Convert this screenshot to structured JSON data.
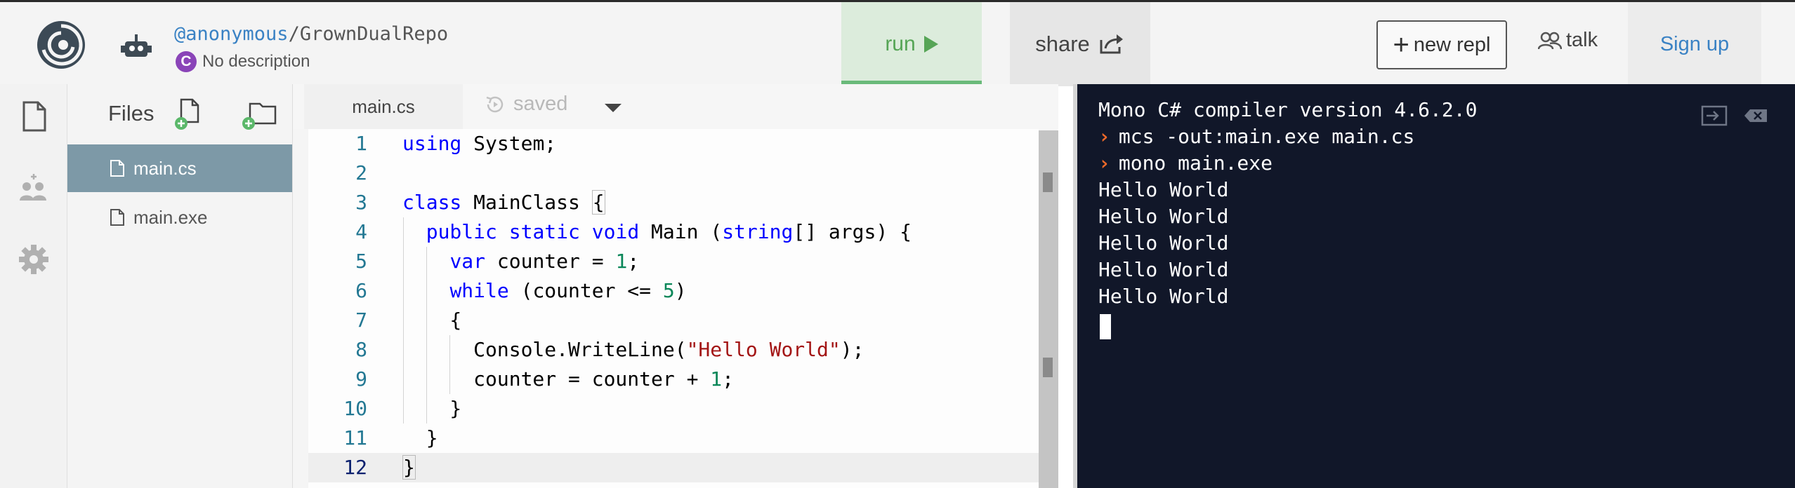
{
  "header": {
    "repo_owner": "@anonymous",
    "repo_separator": "/",
    "repo_name": "GrownDualRepo",
    "description": "No description",
    "language_badge": "C",
    "run_label": "run",
    "share_label": "share",
    "new_repl_label": "new repl",
    "talk_label": "talk",
    "signup_label": "Sign up"
  },
  "rail": {
    "icons": [
      "files-icon",
      "invite-users-icon",
      "settings-gear-icon"
    ]
  },
  "files": {
    "title": "Files",
    "items": [
      {
        "name": "main.cs",
        "active": true
      },
      {
        "name": "main.exe",
        "active": false
      }
    ]
  },
  "editor": {
    "tab_label": "main.cs",
    "status": "saved",
    "current_line": 12,
    "line_numbers": [
      "1",
      "2",
      "3",
      "4",
      "5",
      "6",
      "7",
      "8",
      "9",
      "10",
      "11",
      "12"
    ]
  },
  "console": {
    "lines": [
      "Mono C# compiler version 4.6.2.0",
      "mcs -out:main.exe main.cs",
      "mono main.exe",
      "Hello World",
      "Hello World",
      "Hello World",
      "Hello World",
      "Hello World"
    ],
    "prompt_lines": [
      1,
      2
    ]
  },
  "colors": {
    "accent_link": "#3a82c4",
    "run_green": "#56a556",
    "console_bg": "#111729",
    "file_selected": "#7d99a7",
    "prompt_orange": "#f06a2a"
  }
}
